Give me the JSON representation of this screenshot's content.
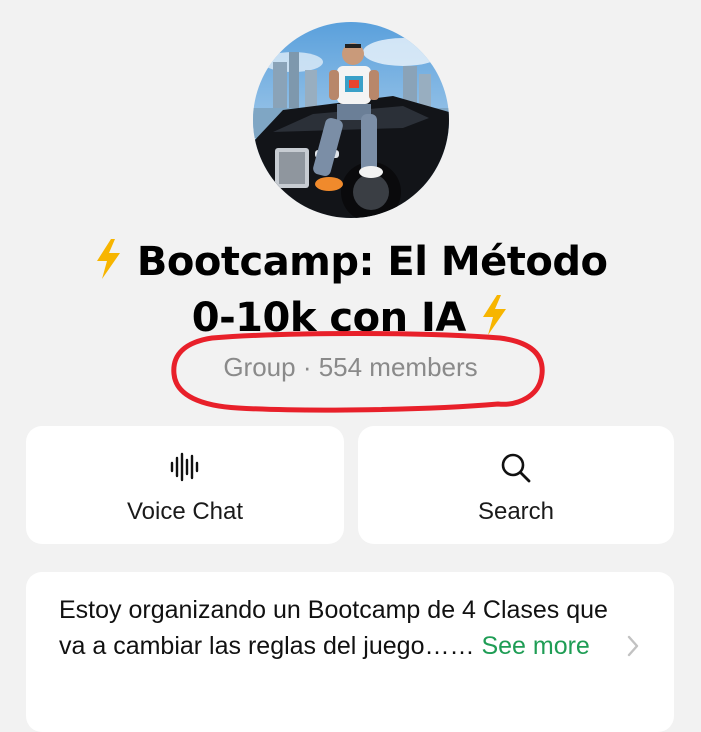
{
  "group": {
    "title_line1": "Bootcamp: El Método",
    "title_line2": "0-10k con IA",
    "bolt_icon": "high-voltage-emoji",
    "subtitle": "Group · 554 members"
  },
  "actions": {
    "voice_chat_label": "Voice Chat",
    "voice_chat_icon": "waveform-icon",
    "search_label": "Search",
    "search_icon": "search-icon"
  },
  "description": {
    "text": "Estoy organizando un Bootcamp de 4 Clases que va a cambiar las reglas del juego……",
    "see_more": "See more",
    "chevron_icon": "chevron-right-icon"
  },
  "colors": {
    "background": "#f2f2f2",
    "card": "#ffffff",
    "link_green": "#1f9d55",
    "annotation_red": "#e8202a",
    "bolt_yellow": "#f7b500"
  }
}
